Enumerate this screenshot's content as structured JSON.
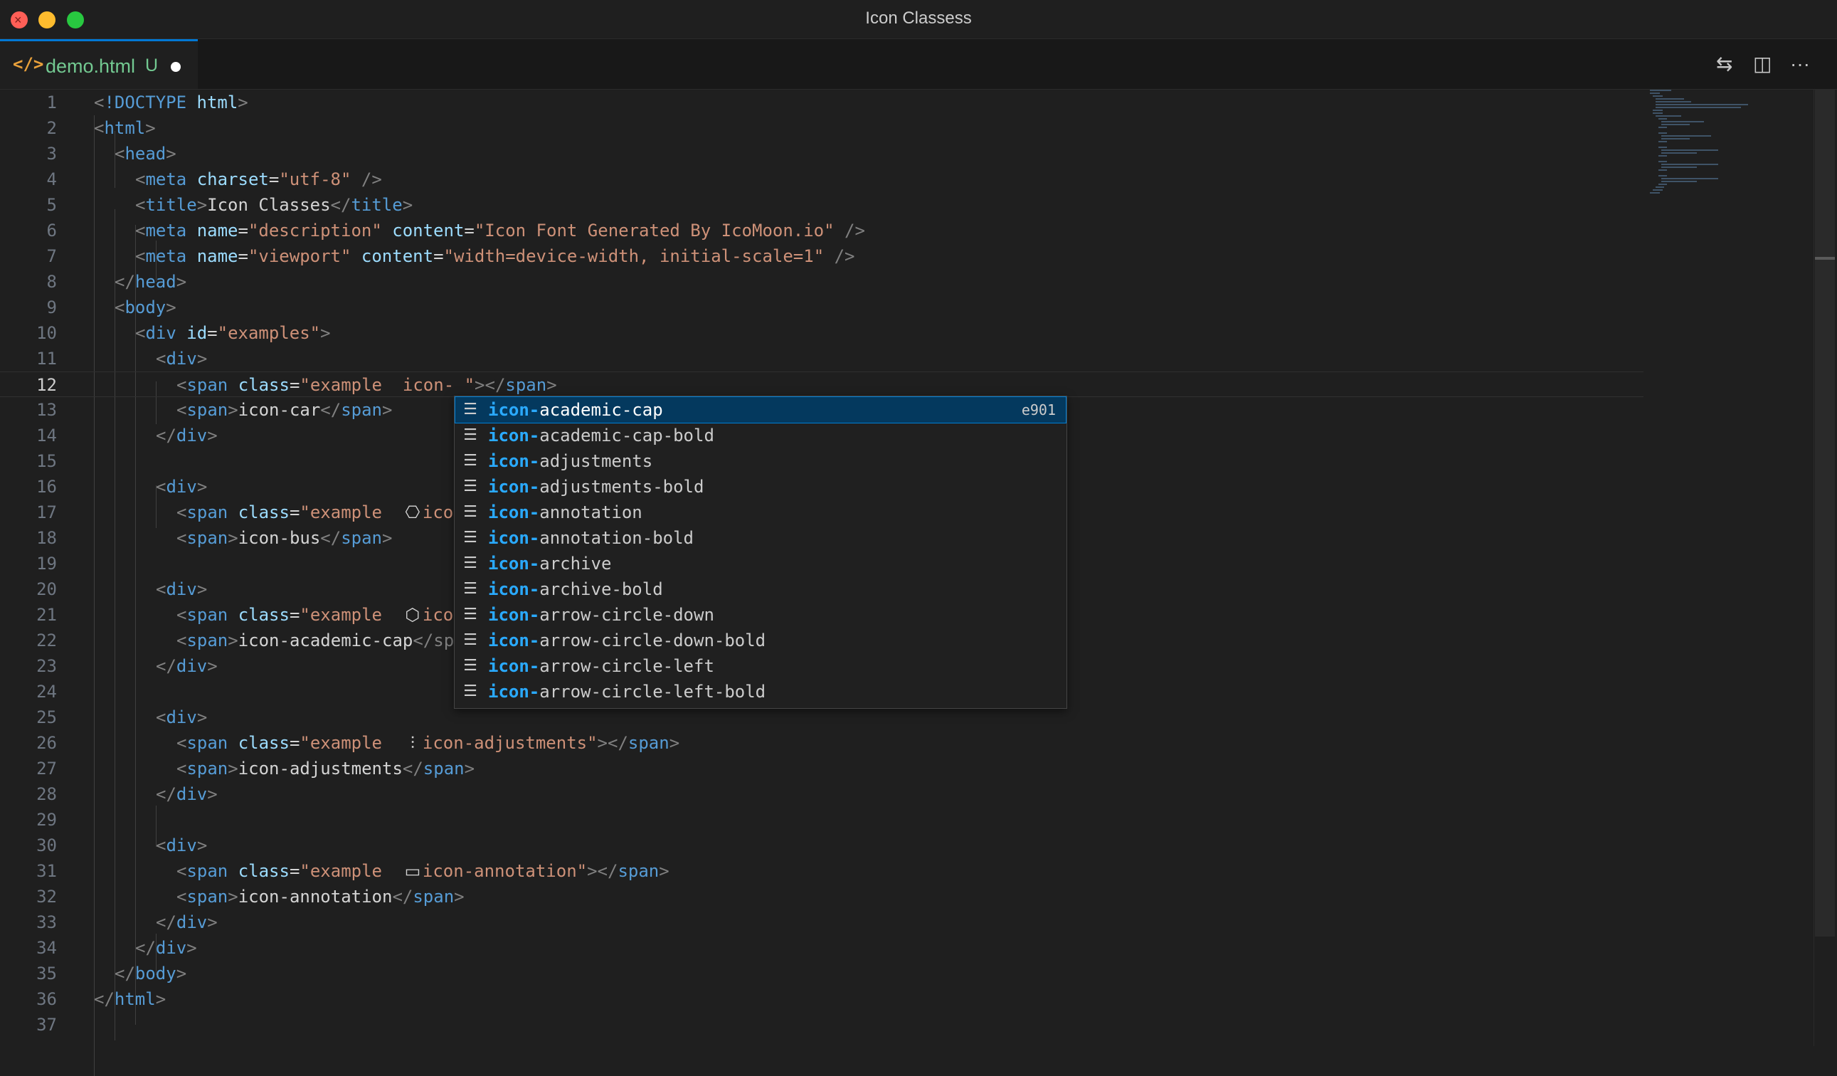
{
  "window": {
    "title": "Icon Classess"
  },
  "tab": {
    "icon": "</>",
    "filename": "demo.html",
    "status": "U"
  },
  "toolbar": {
    "compare_icon": "⇆",
    "split_icon": "◫",
    "more_icon": "···"
  },
  "editor": {
    "current_line": 12,
    "lines": [
      {
        "n": "1"
      },
      {
        "n": "2"
      },
      {
        "n": "3"
      },
      {
        "n": "4"
      },
      {
        "n": "5"
      },
      {
        "n": "6"
      },
      {
        "n": "7"
      },
      {
        "n": "8"
      },
      {
        "n": "9"
      },
      {
        "n": "10"
      },
      {
        "n": "11"
      },
      {
        "n": "12"
      },
      {
        "n": "13"
      },
      {
        "n": "14"
      },
      {
        "n": "15"
      },
      {
        "n": "16"
      },
      {
        "n": "17"
      },
      {
        "n": "18"
      },
      {
        "n": "19"
      },
      {
        "n": "20"
      },
      {
        "n": "21"
      },
      {
        "n": "22"
      },
      {
        "n": "23"
      },
      {
        "n": "24"
      },
      {
        "n": "25"
      },
      {
        "n": "26"
      },
      {
        "n": "27"
      },
      {
        "n": "28"
      },
      {
        "n": "29"
      },
      {
        "n": "30"
      },
      {
        "n": "31"
      },
      {
        "n": "32"
      },
      {
        "n": "33"
      },
      {
        "n": "34"
      },
      {
        "n": "35"
      },
      {
        "n": "36"
      },
      {
        "n": "37"
      }
    ],
    "t": {
      "lt": "<",
      "gt": ">",
      "ltslash": "</",
      "selfclose": " />",
      "eq": "=",
      "sp": " ",
      "doctype": "!DOCTYPE",
      "html": "html",
      "head": "head",
      "meta": "meta",
      "title": "title",
      "body": "body",
      "div": "div",
      "span": "span",
      "charset": "charset",
      "name": "name",
      "content": "content",
      "id": "id",
      "class": "class",
      "utf8": "\"utf-8\"",
      "title_text": "Icon Classes",
      "desc": "\"description\"",
      "desc_content": "\"Icon Font Generated By IcoMoon.io\"",
      "viewport": "\"viewport\"",
      "viewport_content": "\"width=device-width, initial-scale=1\"",
      "examples": "\"examples\"",
      "class12": "\"example  icon- \"",
      "icon_car": "icon-car",
      "class17a": "\"example  ",
      "class17b": "ico",
      "icon_bus": "icon-bus",
      "class21a": "\"example  ",
      "class21b": "ico",
      "icon_academic_cap": "icon-academic-cap",
      "sp_trunc": "</sp",
      "class26a": "\"example  ",
      "class26b": "icon-adjustments\"",
      "icon_adjustments": "icon-adjustments",
      "class31a": "\"example  ",
      "class31b": "icon-annotation\"",
      "icon_annotation": "icon-annotation",
      "glyph_bus": "⎔",
      "glyph_cap": "⬡",
      "glyph_adj": "⫶",
      "glyph_ann": "▭"
    }
  },
  "autocomplete": {
    "match": "icon-",
    "selected_detail": "e901",
    "item_icon": "☰",
    "items": [
      {
        "rest": "academic-cap"
      },
      {
        "rest": "academic-cap-bold"
      },
      {
        "rest": "adjustments"
      },
      {
        "rest": "adjustments-bold"
      },
      {
        "rest": "annotation"
      },
      {
        "rest": "annotation-bold"
      },
      {
        "rest": "archive"
      },
      {
        "rest": "archive-bold"
      },
      {
        "rest": "arrow-circle-down"
      },
      {
        "rest": "arrow-circle-down-bold"
      },
      {
        "rest": "arrow-circle-left"
      },
      {
        "rest": "arrow-circle-left-bold"
      }
    ]
  }
}
